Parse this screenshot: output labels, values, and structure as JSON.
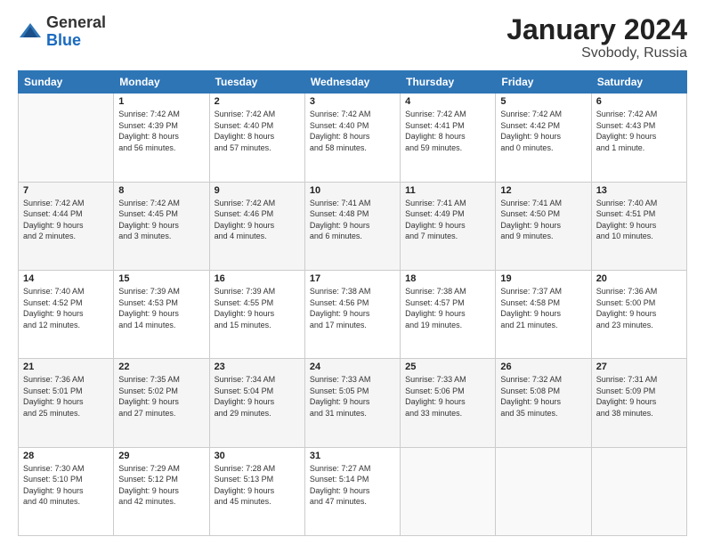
{
  "header": {
    "logo": {
      "general": "General",
      "blue": "Blue"
    },
    "title": "January 2024",
    "subtitle": "Svobody, Russia"
  },
  "calendar": {
    "weekdays": [
      "Sunday",
      "Monday",
      "Tuesday",
      "Wednesday",
      "Thursday",
      "Friday",
      "Saturday"
    ],
    "weeks": [
      [
        {
          "day": "",
          "info": ""
        },
        {
          "day": "1",
          "info": "Sunrise: 7:42 AM\nSunset: 4:39 PM\nDaylight: 8 hours\nand 56 minutes."
        },
        {
          "day": "2",
          "info": "Sunrise: 7:42 AM\nSunset: 4:40 PM\nDaylight: 8 hours\nand 57 minutes."
        },
        {
          "day": "3",
          "info": "Sunrise: 7:42 AM\nSunset: 4:40 PM\nDaylight: 8 hours\nand 58 minutes."
        },
        {
          "day": "4",
          "info": "Sunrise: 7:42 AM\nSunset: 4:41 PM\nDaylight: 8 hours\nand 59 minutes."
        },
        {
          "day": "5",
          "info": "Sunrise: 7:42 AM\nSunset: 4:42 PM\nDaylight: 9 hours\nand 0 minutes."
        },
        {
          "day": "6",
          "info": "Sunrise: 7:42 AM\nSunset: 4:43 PM\nDaylight: 9 hours\nand 1 minute."
        }
      ],
      [
        {
          "day": "7",
          "info": "Sunrise: 7:42 AM\nSunset: 4:44 PM\nDaylight: 9 hours\nand 2 minutes."
        },
        {
          "day": "8",
          "info": "Sunrise: 7:42 AM\nSunset: 4:45 PM\nDaylight: 9 hours\nand 3 minutes."
        },
        {
          "day": "9",
          "info": "Sunrise: 7:42 AM\nSunset: 4:46 PM\nDaylight: 9 hours\nand 4 minutes."
        },
        {
          "day": "10",
          "info": "Sunrise: 7:41 AM\nSunset: 4:48 PM\nDaylight: 9 hours\nand 6 minutes."
        },
        {
          "day": "11",
          "info": "Sunrise: 7:41 AM\nSunset: 4:49 PM\nDaylight: 9 hours\nand 7 minutes."
        },
        {
          "day": "12",
          "info": "Sunrise: 7:41 AM\nSunset: 4:50 PM\nDaylight: 9 hours\nand 9 minutes."
        },
        {
          "day": "13",
          "info": "Sunrise: 7:40 AM\nSunset: 4:51 PM\nDaylight: 9 hours\nand 10 minutes."
        }
      ],
      [
        {
          "day": "14",
          "info": "Sunrise: 7:40 AM\nSunset: 4:52 PM\nDaylight: 9 hours\nand 12 minutes."
        },
        {
          "day": "15",
          "info": "Sunrise: 7:39 AM\nSunset: 4:53 PM\nDaylight: 9 hours\nand 14 minutes."
        },
        {
          "day": "16",
          "info": "Sunrise: 7:39 AM\nSunset: 4:55 PM\nDaylight: 9 hours\nand 15 minutes."
        },
        {
          "day": "17",
          "info": "Sunrise: 7:38 AM\nSunset: 4:56 PM\nDaylight: 9 hours\nand 17 minutes."
        },
        {
          "day": "18",
          "info": "Sunrise: 7:38 AM\nSunset: 4:57 PM\nDaylight: 9 hours\nand 19 minutes."
        },
        {
          "day": "19",
          "info": "Sunrise: 7:37 AM\nSunset: 4:58 PM\nDaylight: 9 hours\nand 21 minutes."
        },
        {
          "day": "20",
          "info": "Sunrise: 7:36 AM\nSunset: 5:00 PM\nDaylight: 9 hours\nand 23 minutes."
        }
      ],
      [
        {
          "day": "21",
          "info": "Sunrise: 7:36 AM\nSunset: 5:01 PM\nDaylight: 9 hours\nand 25 minutes."
        },
        {
          "day": "22",
          "info": "Sunrise: 7:35 AM\nSunset: 5:02 PM\nDaylight: 9 hours\nand 27 minutes."
        },
        {
          "day": "23",
          "info": "Sunrise: 7:34 AM\nSunset: 5:04 PM\nDaylight: 9 hours\nand 29 minutes."
        },
        {
          "day": "24",
          "info": "Sunrise: 7:33 AM\nSunset: 5:05 PM\nDaylight: 9 hours\nand 31 minutes."
        },
        {
          "day": "25",
          "info": "Sunrise: 7:33 AM\nSunset: 5:06 PM\nDaylight: 9 hours\nand 33 minutes."
        },
        {
          "day": "26",
          "info": "Sunrise: 7:32 AM\nSunset: 5:08 PM\nDaylight: 9 hours\nand 35 minutes."
        },
        {
          "day": "27",
          "info": "Sunrise: 7:31 AM\nSunset: 5:09 PM\nDaylight: 9 hours\nand 38 minutes."
        }
      ],
      [
        {
          "day": "28",
          "info": "Sunrise: 7:30 AM\nSunset: 5:10 PM\nDaylight: 9 hours\nand 40 minutes."
        },
        {
          "day": "29",
          "info": "Sunrise: 7:29 AM\nSunset: 5:12 PM\nDaylight: 9 hours\nand 42 minutes."
        },
        {
          "day": "30",
          "info": "Sunrise: 7:28 AM\nSunset: 5:13 PM\nDaylight: 9 hours\nand 45 minutes."
        },
        {
          "day": "31",
          "info": "Sunrise: 7:27 AM\nSunset: 5:14 PM\nDaylight: 9 hours\nand 47 minutes."
        },
        {
          "day": "",
          "info": ""
        },
        {
          "day": "",
          "info": ""
        },
        {
          "day": "",
          "info": ""
        }
      ]
    ]
  }
}
